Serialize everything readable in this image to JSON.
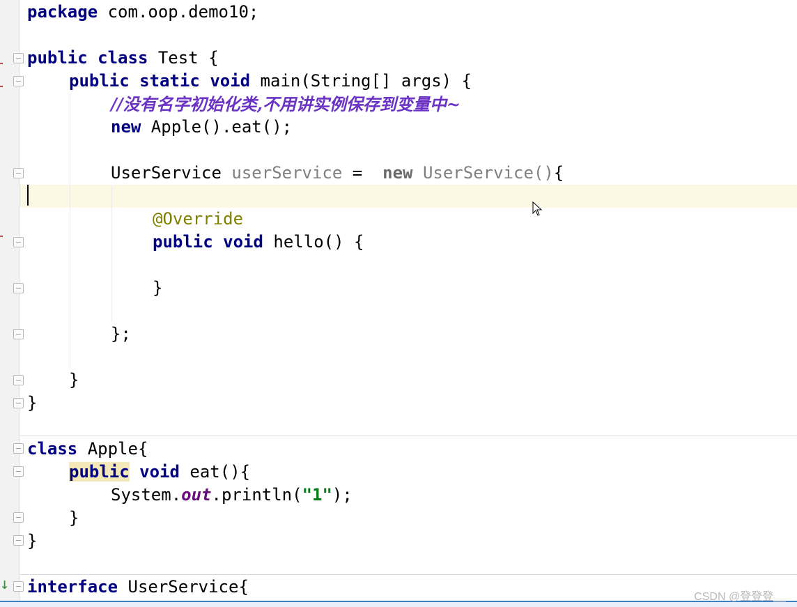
{
  "file": {
    "lines": [
      {
        "tokens": [
          {
            "t": "package",
            "c": "kw"
          },
          {
            "t": " com.oop.demo10;"
          }
        ]
      },
      {
        "tokens": [
          {
            "t": "public",
            "c": "kw"
          },
          {
            "t": " "
          },
          {
            "t": "class",
            "c": "kw"
          },
          {
            "t": " Test {"
          }
        ]
      },
      {
        "tokens": [
          {
            "t": "public",
            "c": "kw"
          },
          {
            "t": " "
          },
          {
            "t": "static",
            "c": "kw"
          },
          {
            "t": " "
          },
          {
            "t": "void",
            "c": "kw"
          },
          {
            "t": " main(String[] args) {"
          }
        ]
      },
      {
        "tokens": [
          {
            "t": "//没有名字初始化类,不用讲实例保存到变量中~",
            "c": "comment"
          }
        ]
      },
      {
        "tokens": [
          {
            "t": "new",
            "c": "kw"
          },
          {
            "t": " Apple().eat();"
          }
        ]
      },
      {
        "tokens": [
          {
            "t": "UserService "
          },
          {
            "t": "userService",
            "c": "gray"
          },
          {
            "t": " =  "
          },
          {
            "t": "new",
            "c": "kw-gray"
          },
          {
            "t": " "
          },
          {
            "t": "UserService()",
            "c": "gray"
          },
          {
            "t": "{"
          }
        ]
      },
      {
        "tokens": []
      },
      {
        "tokens": [
          {
            "t": "@Override",
            "c": "annot"
          }
        ]
      },
      {
        "tokens": [
          {
            "t": "public",
            "c": "kw"
          },
          {
            "t": " "
          },
          {
            "t": "void",
            "c": "kw"
          },
          {
            "t": " hello() {"
          }
        ]
      },
      {
        "tokens": [
          {
            "t": "}"
          }
        ]
      },
      {
        "tokens": [
          {
            "t": "};"
          }
        ]
      },
      {
        "tokens": [
          {
            "t": "}"
          }
        ]
      },
      {
        "tokens": [
          {
            "t": "}"
          }
        ]
      },
      {
        "tokens": [
          {
            "t": "class",
            "c": "kw"
          },
          {
            "t": " Apple{"
          }
        ]
      },
      {
        "tokens": [
          {
            "t": "public",
            "c": "kw kw-hl"
          },
          {
            "t": " "
          },
          {
            "t": "void",
            "c": "kw"
          },
          {
            "t": " eat(){"
          }
        ]
      },
      {
        "tokens": [
          {
            "t": "System."
          },
          {
            "t": "out",
            "c": "static-field"
          },
          {
            "t": ".println("
          },
          {
            "t": "\"1\"",
            "c": "str"
          },
          {
            "t": ");"
          }
        ]
      },
      {
        "tokens": [
          {
            "t": "}"
          }
        ]
      },
      {
        "tokens": [
          {
            "t": "}"
          }
        ]
      },
      {
        "tokens": [
          {
            "t": "interface",
            "c": "kw"
          },
          {
            "t": " UserService{"
          }
        ]
      }
    ]
  },
  "watermark": "CSDN @登登登__",
  "colors": {
    "keyword": "#000080",
    "comment": "#6b33c4",
    "annotation": "#808000",
    "string": "#067d17",
    "unused": "#808080",
    "current_line": "#fdf8e3"
  },
  "icons": {
    "fold": "fold-marker-icon",
    "implemented": "implemented-down-arrow-icon",
    "mouse": "mouse-pointer-icon"
  }
}
